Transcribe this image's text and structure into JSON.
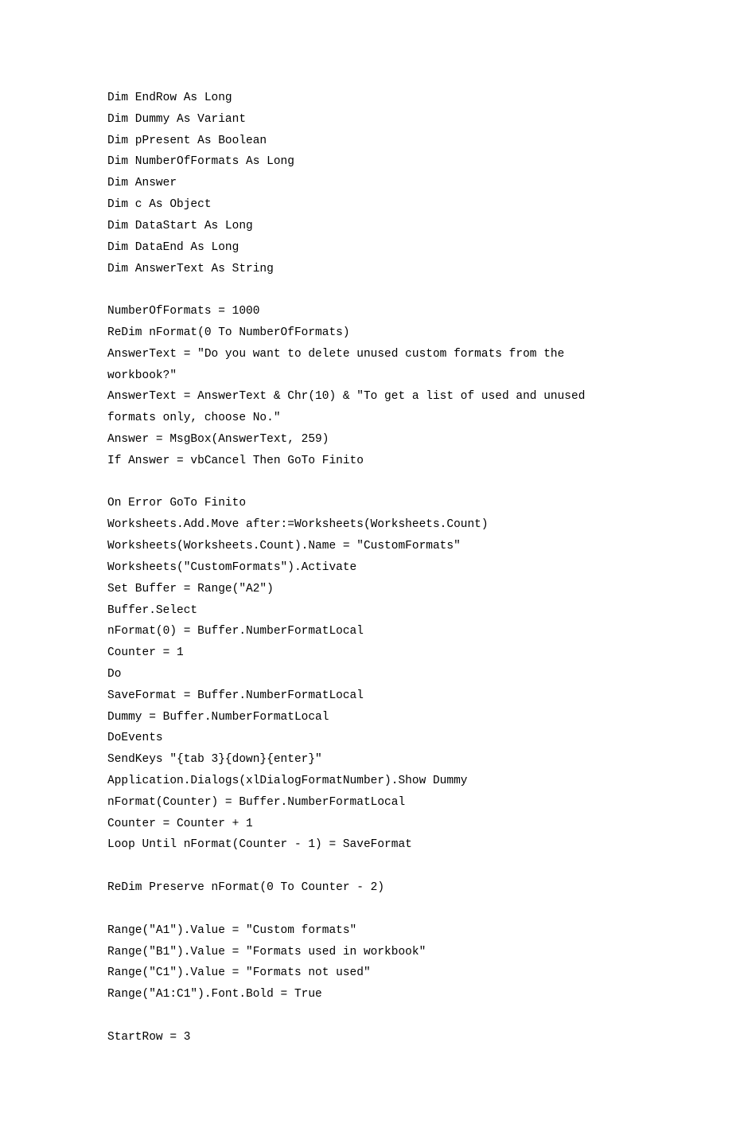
{
  "lines": [
    "Dim EndRow As Long",
    "Dim Dummy As Variant",
    "Dim pPresent As Boolean",
    "Dim NumberOfFormats As Long",
    "Dim Answer",
    "Dim c As Object",
    "Dim DataStart As Long",
    "Dim DataEnd As Long",
    "Dim AnswerText As String",
    "",
    "NumberOfFormats = 1000",
    "ReDim nFormat(0 To NumberOfFormats)",
    "AnswerText = \"Do you want to delete unused custom formats from the workbook?\"",
    "AnswerText = AnswerText & Chr(10) & \"To get a list of used and unused formats only, choose No.\"",
    "Answer = MsgBox(AnswerText, 259)",
    "If Answer = vbCancel Then GoTo Finito",
    "",
    "On Error GoTo Finito",
    "Worksheets.Add.Move after:=Worksheets(Worksheets.Count)",
    "Worksheets(Worksheets.Count).Name = \"CustomFormats\"",
    "Worksheets(\"CustomFormats\").Activate",
    "Set Buffer = Range(\"A2\")",
    "Buffer.Select",
    "nFormat(0) = Buffer.NumberFormatLocal",
    "Counter = 1",
    "Do",
    "SaveFormat = Buffer.NumberFormatLocal",
    "Dummy = Buffer.NumberFormatLocal",
    "DoEvents",
    "SendKeys \"{tab 3}{down}{enter}\"",
    "Application.Dialogs(xlDialogFormatNumber).Show Dummy",
    "nFormat(Counter) = Buffer.NumberFormatLocal",
    "Counter = Counter + 1",
    "Loop Until nFormat(Counter - 1) = SaveFormat",
    "",
    "ReDim Preserve nFormat(0 To Counter - 2)",
    "",
    "Range(\"A1\").Value = \"Custom formats\"",
    "Range(\"B1\").Value = \"Formats used in workbook\"",
    "Range(\"C1\").Value = \"Formats not used\"",
    "Range(\"A1:C1\").Font.Bold = True",
    "",
    "StartRow = 3"
  ]
}
